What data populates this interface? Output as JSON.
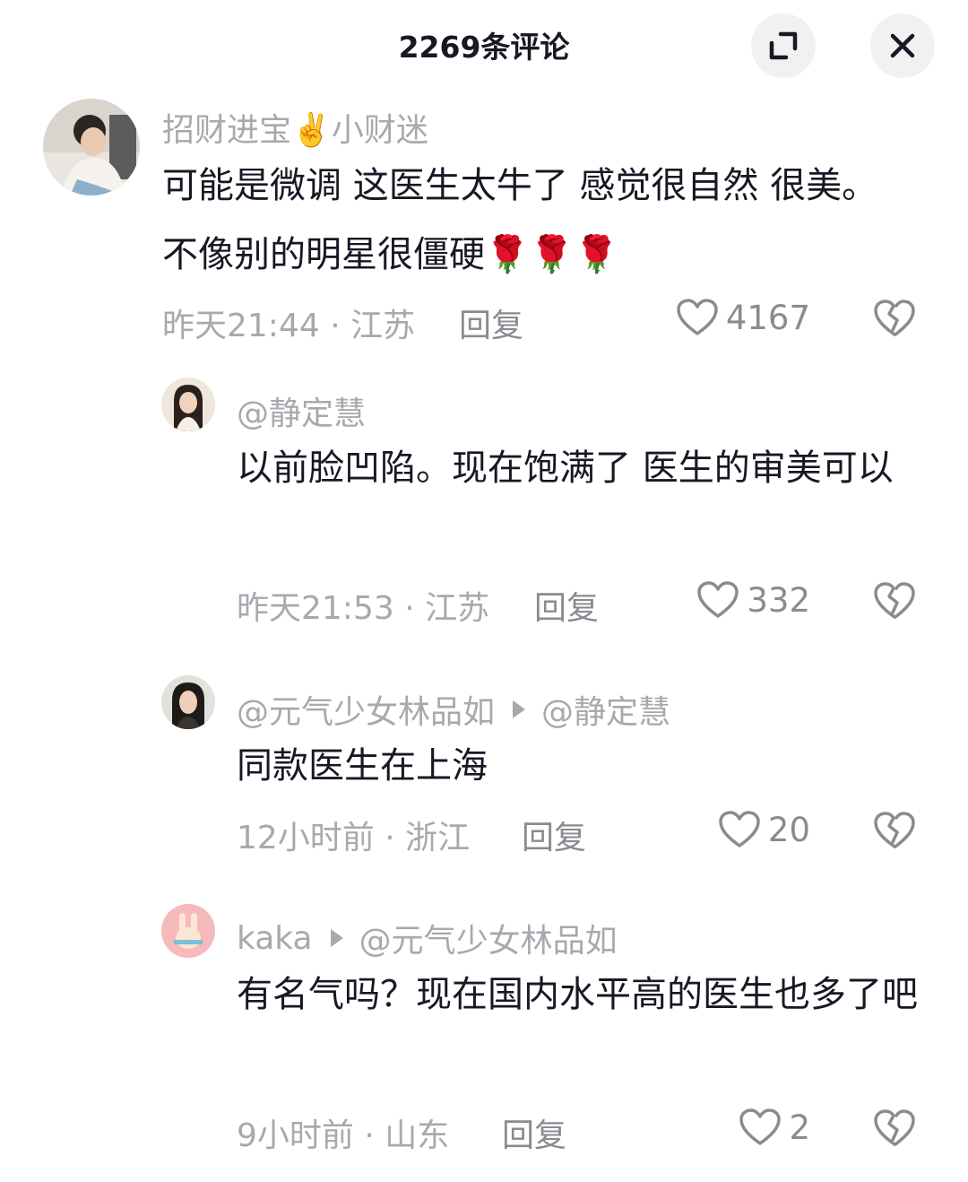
{
  "header": {
    "title": "2269条评论"
  },
  "comments": [
    {
      "username": "招财进宝✌️小财迷",
      "text": "可能是微调 这医生太牛了 感觉很自然 很美。不像别的明星很僵硬🌹🌹🌹",
      "meta": "昨天21:44 · 江苏",
      "reply_label": "回复",
      "likes": "4167"
    },
    {
      "username": "@静定慧",
      "text": "以前脸凹陷。现在饱满了 医生的审美可以",
      "meta": "昨天21:53 · 江苏",
      "reply_label": "回复",
      "likes": "332"
    },
    {
      "username": "@元气少女林品如",
      "reply_to": "@静定慧",
      "text": "同款医生在上海",
      "meta": "12小时前 · 浙江",
      "reply_label": "回复",
      "likes": "20"
    },
    {
      "username": "kaka",
      "reply_to": "@元气少女林品如",
      "text": "有名气吗？现在国内水平高的医生也多了吧",
      "meta": "9小时前 · 山东",
      "reply_label": "回复",
      "likes": "2"
    }
  ],
  "icons": {
    "expand": "expand-icon",
    "close": "close-icon",
    "like": "heart-outline-icon",
    "dislike": "broken-heart-icon"
  },
  "colors": {
    "text": "#161823",
    "muted": "#a8a9ae",
    "button_bg": "#f1f1f2"
  }
}
